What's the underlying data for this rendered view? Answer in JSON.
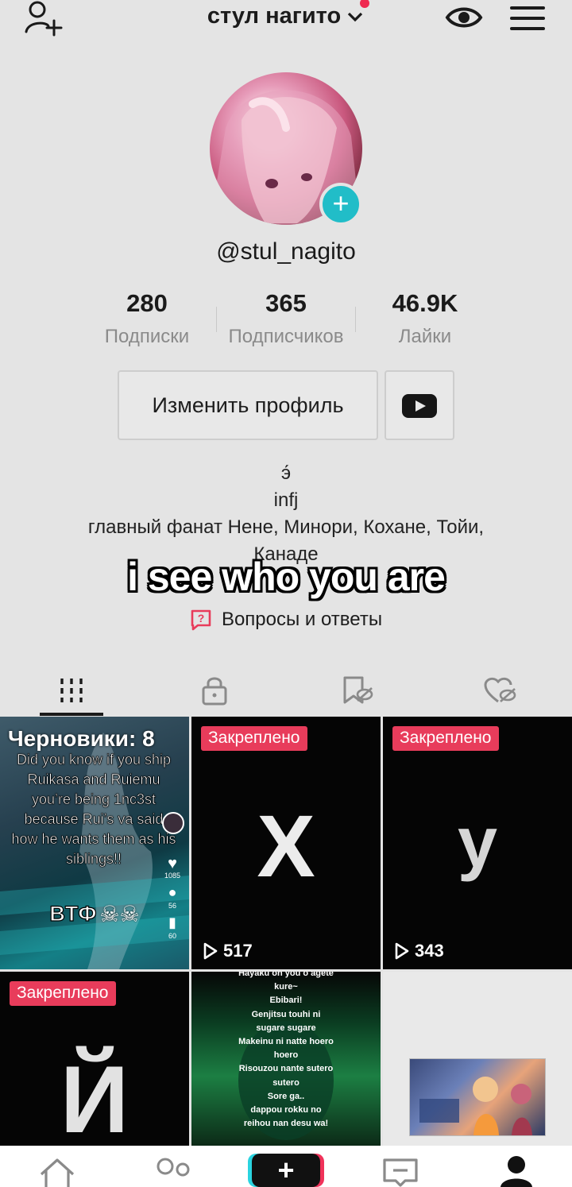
{
  "header": {
    "title": "стул нагито",
    "icons": [
      "add-user-icon",
      "chevron-down-icon",
      "eye-icon",
      "menu-icon"
    ]
  },
  "profile": {
    "handle": "@stul_nagito",
    "stats": [
      {
        "value": "280",
        "label": "Подписки"
      },
      {
        "value": "365",
        "label": "Подписчиков"
      },
      {
        "value": "46.9K",
        "label": "Лайки"
      }
    ],
    "edit_button": "Изменить профиль",
    "bio_lines": [
      "э́",
      "infj",
      "главный фанат Нене, Минори, Кохане, Тойи,",
      "Канаде"
    ],
    "qa_label": "Вопросы и ответы"
  },
  "overlay": {
    "text": "i see who you are"
  },
  "tabs": [
    "videos-grid-icon",
    "lock-icon",
    "bookmark-hidden-icon",
    "heart-hidden-icon"
  ],
  "grid": [
    {
      "type": "drafts",
      "drafts_label": "Черновики: 8",
      "lines": [
        "Did you know if you ship",
        "Ruikasa and Ruiemu",
        "you’re being 1nc3st",
        "because Rui’s va said",
        "how he wants them as his",
        "siblings!!"
      ],
      "caption": "BTФ",
      "counts": [
        "1085",
        "56",
        "60"
      ]
    },
    {
      "type": "pinned",
      "pin": "Закреплено",
      "letter": "Х",
      "views": "517"
    },
    {
      "type": "pinned",
      "pin": "Закреплено",
      "letter": "у",
      "views": "343"
    },
    {
      "type": "pinned",
      "pin": "Закреплено",
      "letter": "Й"
    },
    {
      "type": "lyrics",
      "lines": [
        "Hayaku oh you o agete",
        "kure~",
        "Ebibari!",
        "Genjitsu touhi ni",
        "sugare sugare",
        "Makeinu ni natte hoero",
        "hoero",
        "Risouzou nante sutero",
        "sutero",
        "Sore ga..",
        "dappou rokku no",
        "reihou nan desu wa!"
      ]
    },
    {
      "type": "image"
    }
  ],
  "colors": {
    "background": "#e4e4e4",
    "pin_red": "#e83c5b",
    "avatar_plus": "#21bdc8",
    "notification_dot": "#ef2950"
  },
  "bottom_nav_icons": [
    "home-icon",
    "friends-icon",
    "create-plus-icon",
    "inbox-icon",
    "profile-icon"
  ]
}
